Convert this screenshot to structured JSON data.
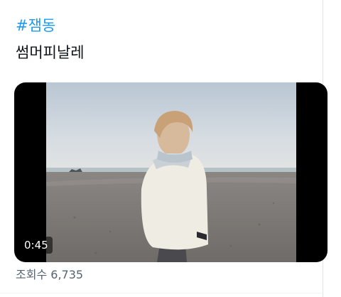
{
  "tweet": {
    "hashtag": "#잼동",
    "text": "썸머피날레",
    "views_label": "조회수",
    "views_count": "6,735"
  },
  "video": {
    "duration": "0:45"
  },
  "colors": {
    "link": "#1d9bf0",
    "text": "#0f1419",
    "secondary_text": "#536471",
    "video_bg": "#000000"
  }
}
